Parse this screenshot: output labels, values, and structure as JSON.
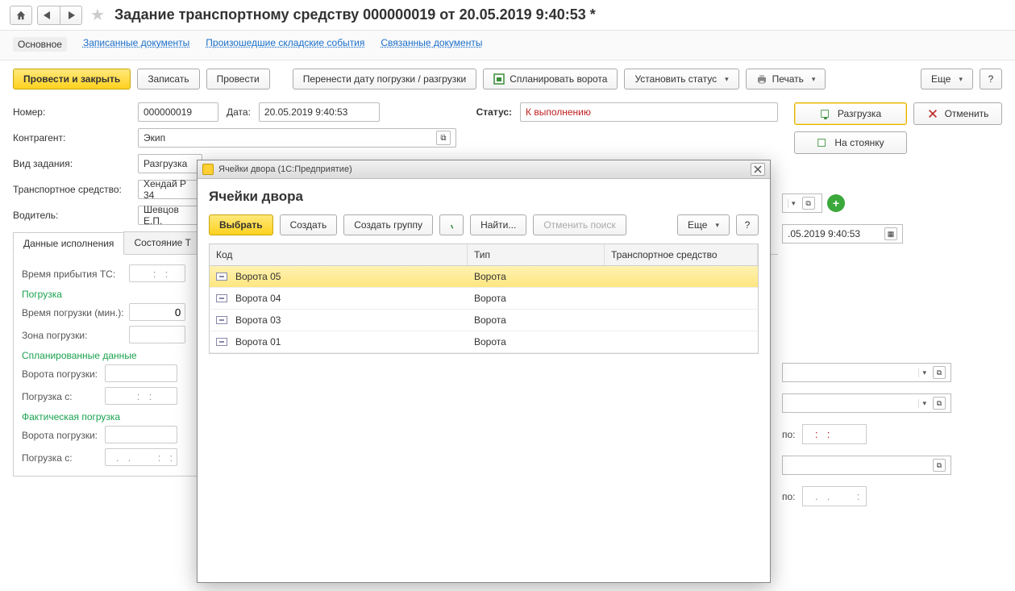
{
  "header": {
    "title": "Задание транспортному средству 000000019 от 20.05.2019 9:40:53 *"
  },
  "section_tabs": {
    "main": "Основное",
    "docs": "Записанные документы",
    "events": "Произошедшие складские события",
    "related": "Связанные документы"
  },
  "toolbar": {
    "post_close": "Провести и закрыть",
    "save": "Записать",
    "post": "Провести",
    "move_date": "Перенести дату погрузки / разгрузки",
    "plan_gates": "Спланировать ворота",
    "set_status": "Установить статус",
    "print": "Печать",
    "more": "Еще",
    "help": "?"
  },
  "side_actions": {
    "unload": "Разгрузка",
    "cancel": "Отменить",
    "to_parking": "На стоянку"
  },
  "form": {
    "number_label": "Номер:",
    "number_value": "000000019",
    "date_label": "Дата:",
    "date_value": "20.05.2019  9:40:53",
    "status_label": "Статус:",
    "status_value": "К выполнению",
    "contractor_label": "Контрагент:",
    "contractor_value": "Экип",
    "tasktype_label": "Вид задания:",
    "tasktype_value": "Разгрузка",
    "vehicle_label": "Транспортное средство:",
    "vehicle_value": "Хендай Р 34",
    "driver_label": "Водитель:",
    "driver_value": "Шевцов Е.П.",
    "right_date": ".05.2019 9:40:53"
  },
  "tabs": {
    "exec": "Данные исполнения",
    "state": "Состояние Т"
  },
  "exec": {
    "arrival_label": "Время прибытия ТС:",
    "arrival_value": "  :   :",
    "loading_heading": "Погрузка",
    "loadtime_label": "Время погрузки (мин.):",
    "loadtime_value": "0",
    "loadzone_label": "Зона погрузки:",
    "planned_heading": "Спланированные данные",
    "gates_label": "Ворота погрузки:",
    "from_label": "Погрузка с:",
    "from_value": "  :   :",
    "actual_heading": "Фактическая погрузка",
    "actual_gates_label": "Ворота погрузки:",
    "actual_from_label": "Погрузка с:",
    "actual_from_value": "  .   .         :   :"
  },
  "right_fields": {
    "po_label": "по:",
    "po_value": "  :   :",
    "po_value2": "  .   .         :   :"
  },
  "dialog": {
    "window_title": "Ячейки двора  (1С:Предприятие)",
    "heading": "Ячейки двора",
    "select": "Выбрать",
    "create": "Создать",
    "create_group": "Создать группу",
    "find": "Найти...",
    "cancel_find": "Отменить поиск",
    "more": "Еще",
    "help": "?",
    "col_code": "Код",
    "col_type": "Тип",
    "col_vehicle": "Транспортное средство",
    "rows": [
      {
        "code": "Ворота 05",
        "type": "Ворота"
      },
      {
        "code": "Ворота 04",
        "type": "Ворота"
      },
      {
        "code": "Ворота 03",
        "type": "Ворота"
      },
      {
        "code": "Ворота 01",
        "type": "Ворота"
      }
    ]
  }
}
